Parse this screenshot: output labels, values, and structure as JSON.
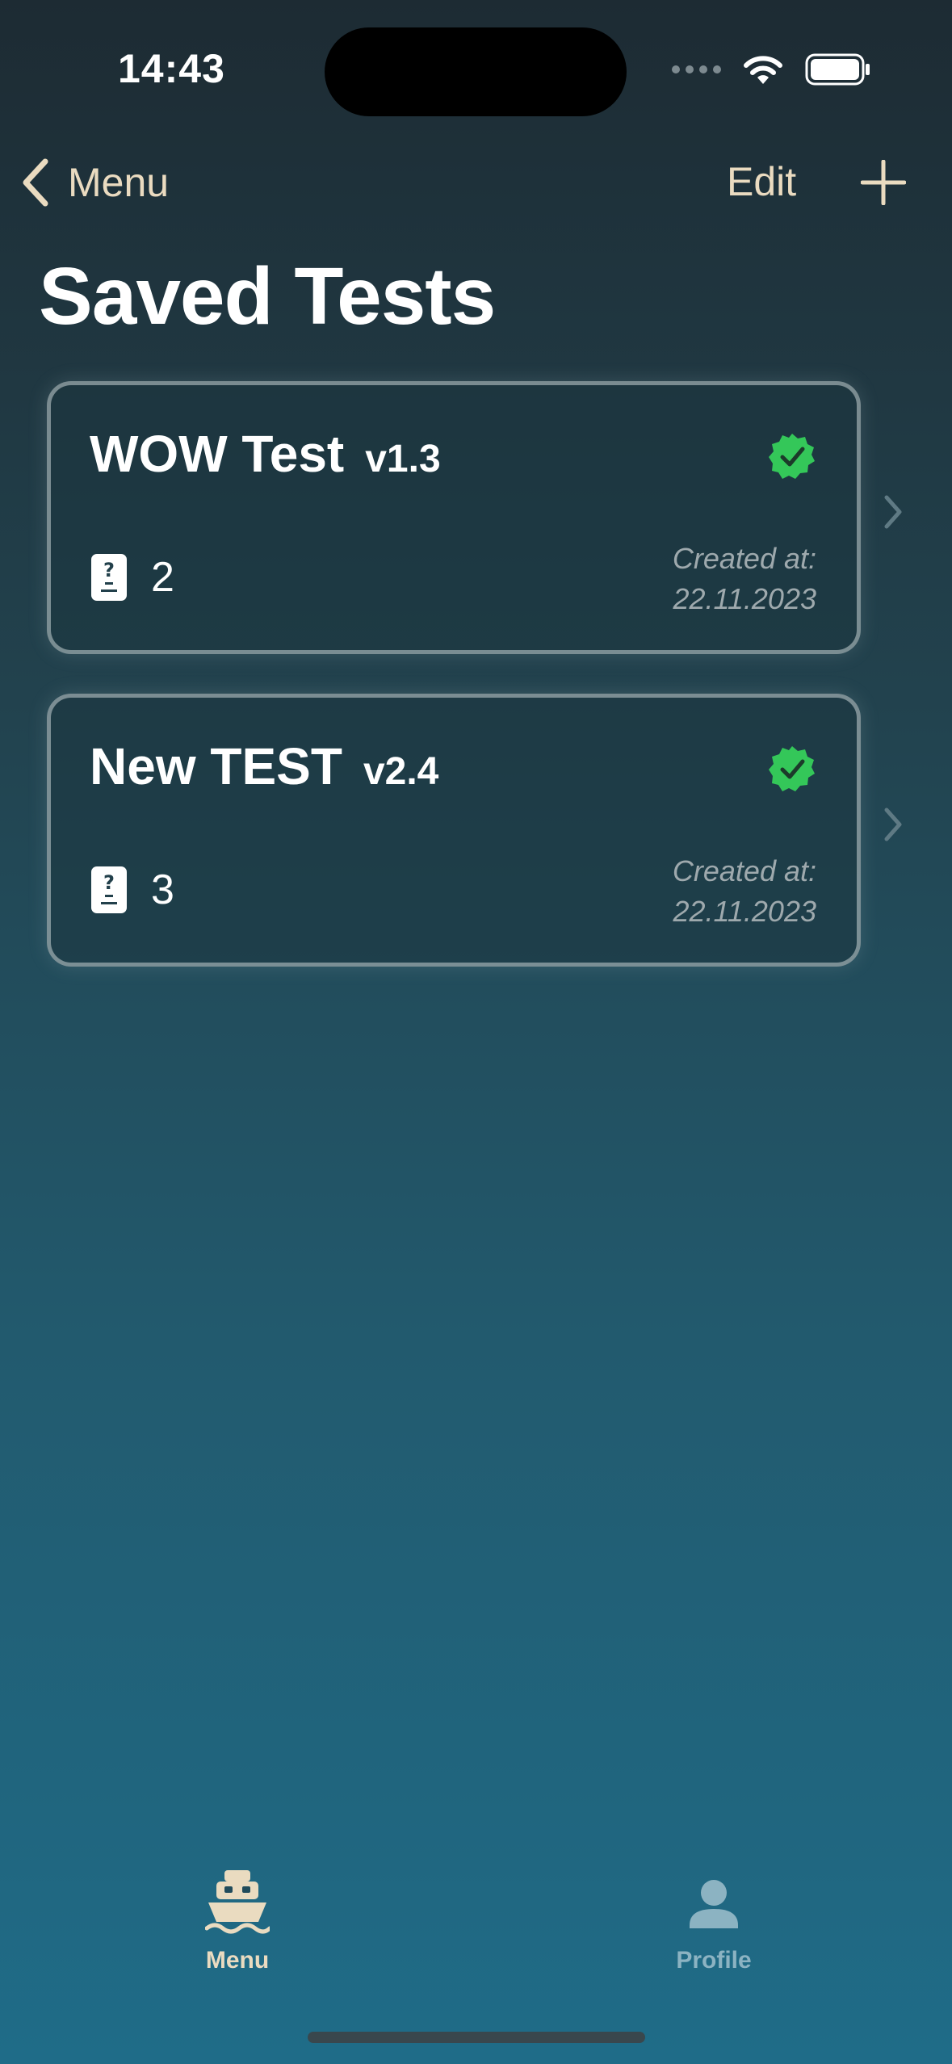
{
  "status_bar": {
    "time": "14:43"
  },
  "nav": {
    "back_label": "Menu",
    "edit_label": "Edit"
  },
  "page": {
    "title": "Saved Tests"
  },
  "tests": [
    {
      "name": "WOW Test",
      "version": "v1.3",
      "count": "2",
      "created_label": "Created at:",
      "created_date": "22.11.2023",
      "verified": true
    },
    {
      "name": "New TEST",
      "version": "v2.4",
      "count": "3",
      "created_label": "Created at:",
      "created_date": "22.11.2023",
      "verified": true
    }
  ],
  "tab_bar": {
    "items": [
      {
        "label": "Menu",
        "icon": "ship-icon",
        "active": true
      },
      {
        "label": "Profile",
        "icon": "person-icon",
        "active": false
      }
    ]
  },
  "colors": {
    "accent": "#eadbc0",
    "verified": "#34c759",
    "inactive_tab": "#8cb3c2"
  }
}
